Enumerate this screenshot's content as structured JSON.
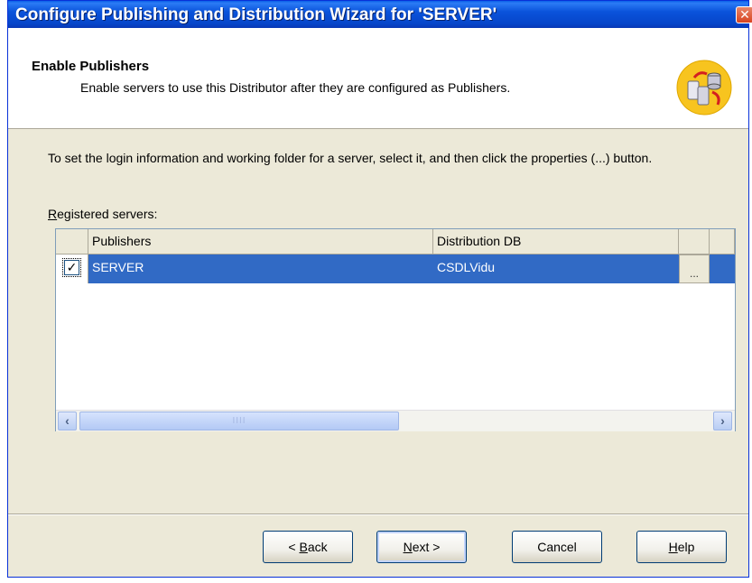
{
  "window": {
    "title": "Configure Publishing and Distribution Wizard for 'SERVER'",
    "close_glyph": "✕"
  },
  "header": {
    "title": "Enable Publishers",
    "subtitle": "Enable servers to use this Distributor after they are configured as Publishers.",
    "icon": "servers-distribution-icon"
  },
  "body": {
    "instruction": "To set the login information and working folder for a server, select it, and then click the properties (...) button.",
    "registered_label": "Registered servers:",
    "registered_label_mnemonic": "R",
    "registered_label_rest": "egistered servers:"
  },
  "grid": {
    "columns": [
      "Publishers",
      "Distribution DB"
    ],
    "rows": [
      {
        "checked": true,
        "check_glyph": "✓",
        "publisher": "SERVER",
        "distribution_db": "CSDLVidu",
        "properties_label": "..."
      }
    ],
    "scrollbar": {
      "left_arrow": "‹",
      "right_arrow": "›",
      "grip": "IIII"
    }
  },
  "buttons": {
    "back": {
      "prefix": "< ",
      "mnemonic": "B",
      "rest": "ack"
    },
    "next": {
      "mnemonic": "N",
      "rest": "ext >"
    },
    "cancel": "Cancel",
    "help": {
      "mnemonic": "H",
      "rest": "elp"
    }
  },
  "colors": {
    "titlebar": "#0a53db",
    "selection": "#316ac5",
    "dialog_bg": "#ece9d8"
  }
}
